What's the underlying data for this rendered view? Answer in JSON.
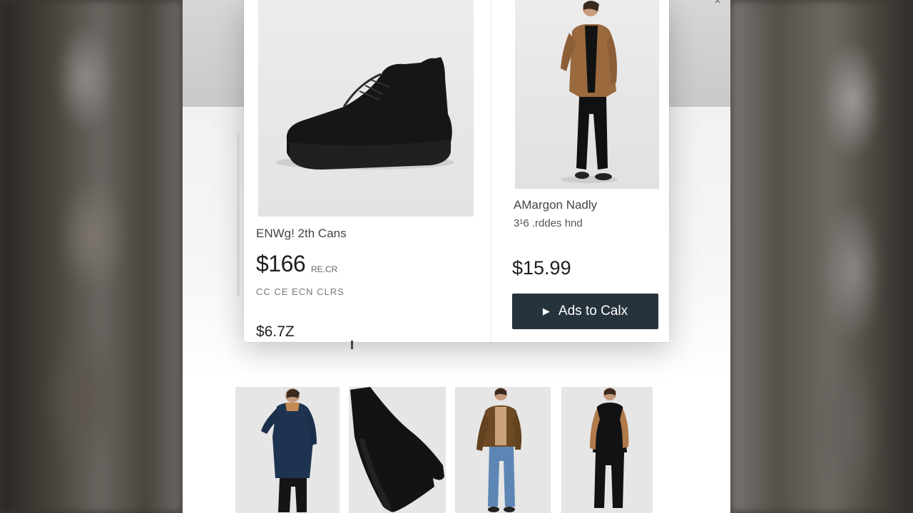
{
  "quick_view": {
    "left_product": {
      "name": "ENWg! 2th Cans",
      "price": "$166",
      "price_suffix": "RE.CR",
      "meta": "CC CE ECN CLRS",
      "old_price": "$6.7Z"
    },
    "right_product": {
      "name": "AMargon Nadly",
      "meta": "3¹6 .rddes  hnd",
      "price": "$15.99",
      "add_to_cart_label": "Ads to Calx"
    }
  },
  "icons": {
    "close": "close-icon",
    "play": "play-icon"
  },
  "colors": {
    "button": "#26323c",
    "page_bg": "#ffffff"
  }
}
